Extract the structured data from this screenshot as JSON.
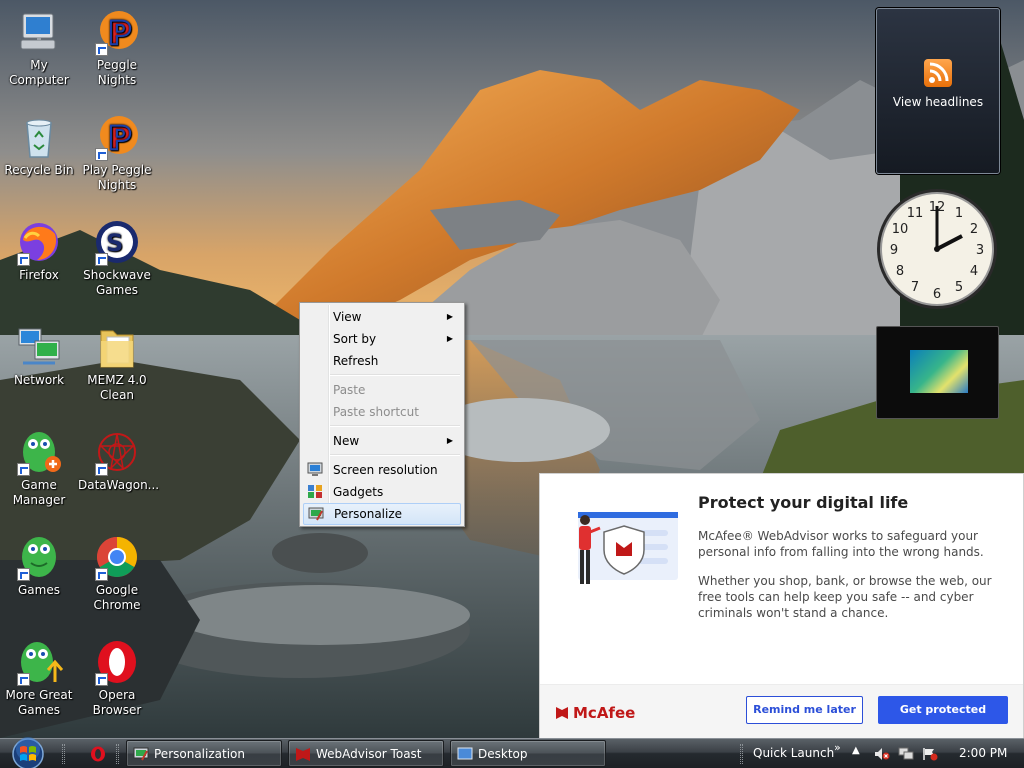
{
  "desktop": {
    "icons": [
      {
        "label": "My Computer",
        "icon": "computer-icon"
      },
      {
        "label": "Peggle Nights",
        "icon": "peggle-icon"
      },
      {
        "label": "Recycle Bin",
        "icon": "recycle-bin-icon"
      },
      {
        "label": "Play Peggle Nights",
        "icon": "peggle-icon"
      },
      {
        "label": "Firefox",
        "icon": "firefox-icon"
      },
      {
        "label": "Shockwave Games",
        "icon": "shockwave-icon"
      },
      {
        "label": "Network",
        "icon": "network-icon"
      },
      {
        "label": "MEMZ 4.0 Clean",
        "icon": "folder-icon"
      },
      {
        "label": "Game Manager",
        "icon": "game-manager-icon"
      },
      {
        "label": "DataWagon...",
        "icon": "datawagon-icon"
      },
      {
        "label": "Games",
        "icon": "games-icon"
      },
      {
        "label": "Google Chrome",
        "icon": "chrome-icon"
      },
      {
        "label": "More Great Games",
        "icon": "more-games-icon"
      },
      {
        "label": "Opera Browser",
        "icon": "opera-icon"
      }
    ]
  },
  "gadgets": {
    "feed_label": "View headlines",
    "clock_time": "2:00"
  },
  "context_menu": {
    "view": "View",
    "sort_by": "Sort by",
    "refresh": "Refresh",
    "paste": "Paste",
    "paste_shortcut": "Paste shortcut",
    "new": "New",
    "screen_resolution": "Screen resolution",
    "gadgets": "Gadgets",
    "personalize": "Personalize",
    "submenu_arrow": "▶"
  },
  "toast": {
    "title": "Protect your digital life",
    "paragraph1": "McAfee® WebAdvisor works to safeguard your personal info from falling into the wrong hands.",
    "paragraph2": "Whether you shop, bank, or browse the web, our free tools can help keep you safe -- and cyber criminals won't stand a chance.",
    "brand": "McAfee",
    "remind_button": "Remind me later",
    "protect_button": "Get protected",
    "accent_color": "#2d57e8",
    "brand_color": "#c01818"
  },
  "taskbar": {
    "buttons": [
      {
        "label": "Personalization",
        "icon": "personalization-icon"
      },
      {
        "label": "WebAdvisor Toast",
        "icon": "mcafee-icon"
      },
      {
        "label": "Desktop",
        "icon": "desktop-icon"
      }
    ],
    "quick_launch": "Quick Launch",
    "chevron": "»",
    "tray_arrow": "▲",
    "clock": "2:00 PM"
  }
}
